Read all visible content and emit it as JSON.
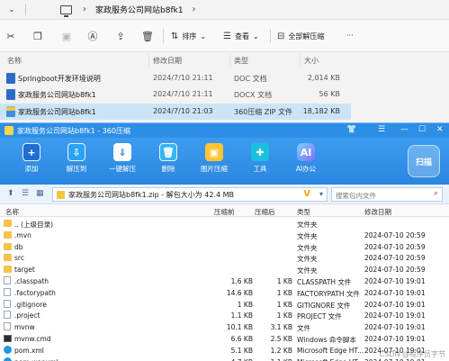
{
  "explorer": {
    "path": "家政服务公司网站b8fk1",
    "toolbar": {
      "sort_label": "排序",
      "view_label": "查看",
      "extract_all_label": "全部解压缩",
      "more_label": "···"
    },
    "columns": [
      "名称",
      "修改日期",
      "类型",
      "大小"
    ],
    "files": [
      {
        "name": "Springboot开发环境说明",
        "date": "2024/7/10 21:11",
        "type": "DOC 文档",
        "size": "2,014 KB",
        "icon": "word-doc-icon"
      },
      {
        "name": "家政服务公司网站b8fk1",
        "date": "2024/7/10 21:11",
        "type": "DOCX 文档",
        "size": "56 KB",
        "icon": "word-docx-icon"
      },
      {
        "name": "家政服务公司网站b8fk1",
        "date": "2024/7/10 21:03",
        "type": "360压缩 ZIP 文件",
        "size": "18,182 KB",
        "icon": "zip-icon",
        "selected": true
      }
    ]
  },
  "zip": {
    "title": "家政服务公司网站b8fk1 - 360压缩",
    "menu_icons": [
      "shirt-icon",
      "menu-icon",
      "minimize-icon",
      "maximize-icon",
      "close-icon"
    ],
    "tools": [
      {
        "label": "添加",
        "icon": "add-icon"
      },
      {
        "label": "解压到",
        "icon": "extract-to-icon"
      },
      {
        "label": "一键解压",
        "icon": "one-click-extract-icon"
      },
      {
        "label": "删除",
        "icon": "delete-icon"
      },
      {
        "label": "图片压缩",
        "icon": "image-compress-icon"
      },
      {
        "label": "工具",
        "icon": "tools-icon"
      },
      {
        "label": "AI办公",
        "icon": "ai-office-icon",
        "glyph": "AI"
      }
    ],
    "scan_label": "扫描",
    "address": "家政服务公司网站b8fk1.zip - 解包大小为 42.4 MB",
    "search_placeholder": "搜索包内文件",
    "columns": [
      "名称",
      "压缩前",
      "压缩后",
      "类型",
      "修改日期"
    ],
    "rows": [
      {
        "name": ".. (上级目录)",
        "before": "",
        "after": "",
        "type": "文件夹",
        "date": "",
        "icon": "folder"
      },
      {
        "name": ".mvn",
        "before": "",
        "after": "",
        "type": "文件夹",
        "date": "2024-07-10 20:59",
        "icon": "folder"
      },
      {
        "name": "db",
        "before": "",
        "after": "",
        "type": "文件夹",
        "date": "2024-07-10 20:59",
        "icon": "folder"
      },
      {
        "name": "src",
        "before": "",
        "after": "",
        "type": "文件夹",
        "date": "2024-07-10 20:59",
        "icon": "folder"
      },
      {
        "name": "target",
        "before": "",
        "after": "",
        "type": "文件夹",
        "date": "2024-07-10 20:59",
        "icon": "folder"
      },
      {
        "name": ".classpath",
        "before": "1.6 KB",
        "after": "1 KB",
        "type": "CLASSPATH 文件",
        "date": "2024-07-10 19:01",
        "icon": "file"
      },
      {
        "name": ".factorypath",
        "before": "14.6 KB",
        "after": "1 KB",
        "type": "FACTORYPATH 文件",
        "date": "2024-07-10 19:01",
        "icon": "file"
      },
      {
        "name": ".gitignore",
        "before": "1 KB",
        "after": "1 KB",
        "type": "GITIGNORE 文件",
        "date": "2024-07-10 19:01",
        "icon": "file"
      },
      {
        "name": ".project",
        "before": "1.1 KB",
        "after": "1 KB",
        "type": "PROJECT 文件",
        "date": "2024-07-10 19:01",
        "icon": "file"
      },
      {
        "name": "mvnw",
        "before": "10.1 KB",
        "after": "3.1 KB",
        "type": "文件",
        "date": "2024-07-10 19:01",
        "icon": "file"
      },
      {
        "name": "mvnw.cmd",
        "before": "6.6 KB",
        "after": "2.5 KB",
        "type": "Windows 命令脚本",
        "date": "2024-07-10 19:01",
        "icon": "cmd"
      },
      {
        "name": "pom.xml",
        "before": "5.1 KB",
        "after": "1.2 KB",
        "type": "Microsoft Edge HT...",
        "date": "2024-07-10 19:01",
        "icon": "edge"
      },
      {
        "name": "pom-war.xml",
        "before": "4.7 KB",
        "after": "1.1 KB",
        "type": "Microsoft Edge HT...",
        "date": "2024-07-10 19:01",
        "icon": "edge"
      }
    ],
    "watermark": "CSDN @程序员字节"
  }
}
